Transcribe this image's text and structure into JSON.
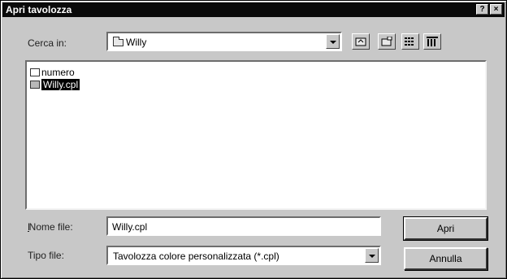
{
  "window": {
    "title": "Apri tavolozza",
    "help_button": "?",
    "close_button": "×"
  },
  "look_in": {
    "label": "Cerca in:",
    "value": "Willy"
  },
  "toolbar": {
    "icons": [
      "up-folder-icon",
      "new-folder-icon",
      "list-view-icon",
      "details-view-icon"
    ]
  },
  "file_list": {
    "items": [
      {
        "name": "numero",
        "type": "folder",
        "selected": false
      },
      {
        "name": "Willy.cpl",
        "type": "file",
        "selected": true
      }
    ]
  },
  "file_name": {
    "label": "Nome file:",
    "value": "Willy.cpl"
  },
  "file_type": {
    "label": "Tipo file:",
    "value": "Tavolozza colore personalizzata (*.cpl)"
  },
  "buttons": {
    "open": "Apri",
    "cancel": "Annulla"
  }
}
